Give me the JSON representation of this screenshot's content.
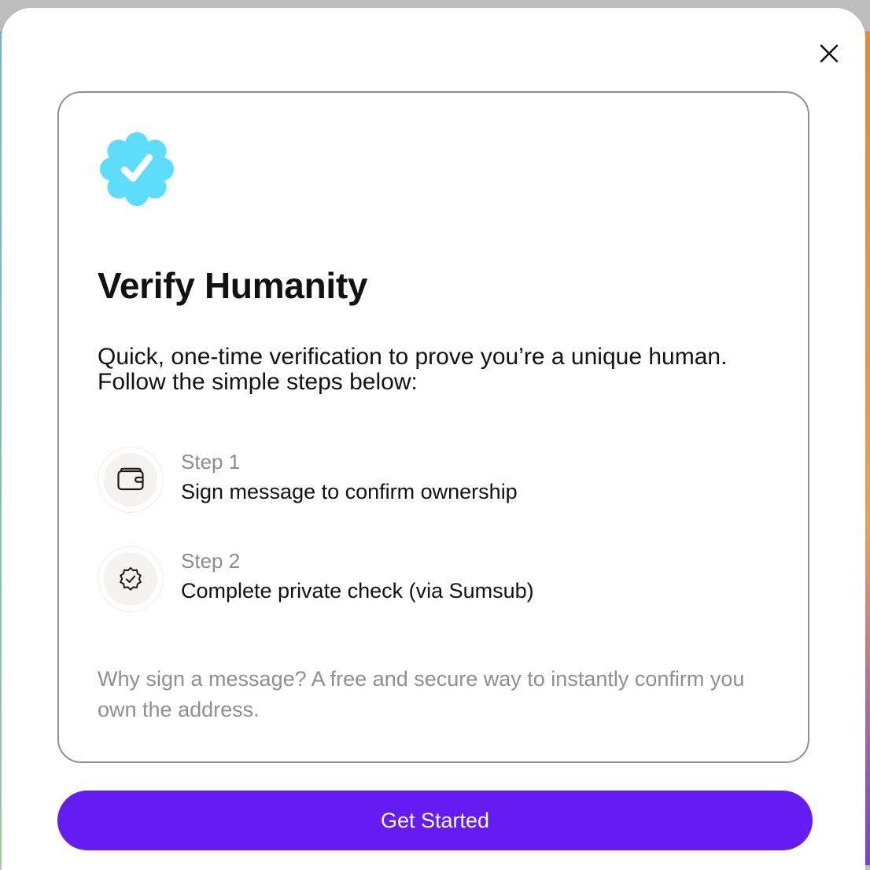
{
  "dialog": {
    "close_icon": "close-icon",
    "badge_icon": "verified-badge-icon",
    "title": "Verify Humanity",
    "intro": "Quick, one-time verification to prove you’re a unique human. Follow the simple steps below:",
    "steps": [
      {
        "icon": "wallet-icon",
        "label": "Step 1",
        "description": "Sign message to confirm ownership"
      },
      {
        "icon": "badge-check-icon",
        "label": "Step 2",
        "description": "Complete private check (via Sumsub)"
      }
    ],
    "note": "Why sign a message? A free and secure way to instantly confirm you own the address.",
    "cta_label": "Get Started"
  },
  "colors": {
    "accent": "#651cf0",
    "badge": "#5ddcfb",
    "muted_text": "#8c8c8c",
    "text": "#121212"
  }
}
